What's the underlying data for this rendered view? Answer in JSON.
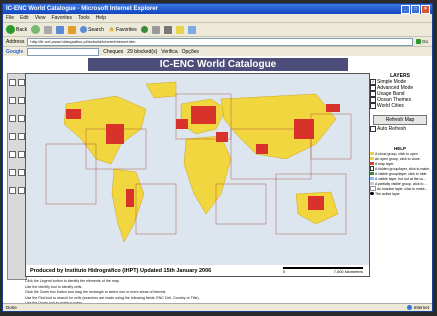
{
  "window": {
    "title": "IC-ENC World Catalogue - Microsoft Internet Explorer"
  },
  "menubar": [
    "File",
    "Edit",
    "View",
    "Favorites",
    "Tools",
    "Help"
  ],
  "toolbar": {
    "back": "Back",
    "search": "Search",
    "favorites": "Favorites"
  },
  "address": {
    "label": "Address",
    "url": "http://ifr-net-www.hidrografico.pt/iscbuild/ichere/internet.htm",
    "go": "Go"
  },
  "googlebar": {
    "label": "Google",
    "checks": "Cheques",
    "blocked": "29 blocked(s)",
    "check": "Verifica",
    "options": "Opções"
  },
  "page": {
    "title": "IC-ENC World Catalogue",
    "credit": "Produced by Instituto Hidrográfico (IHPT) Updated 15th January 2006",
    "scale": {
      "left": "0",
      "right": "7,500 kilometers"
    }
  },
  "layers": {
    "heading": "LAYERS",
    "items": [
      "Simple Mode",
      "Advanced Mode",
      "Usage Band",
      "Ocean Themes",
      "World Cities"
    ],
    "checked": [
      true,
      false,
      false,
      false,
      false
    ],
    "refresh_label": "Refresh Map",
    "auto_refresh": "Auto Refresh"
  },
  "help": {
    "heading": "HELP",
    "items": [
      "A cloud group, click to open.",
      "An open group, click to close.",
      "A map layer.",
      "A hidden group/layer, click to make.",
      "A visible group/layer, click to hide.",
      "A visible layer, but not at the cu...",
      "A partially visible group, click to ...",
      "An inactive layer, click to make...",
      "The active layer."
    ],
    "colors": [
      "#e8d44a",
      "#e8d44a",
      "#d94a2a",
      "#ffffff",
      "#3a8a3a",
      "#7fbfff",
      "#cccccc",
      "#ffffff",
      "#000000"
    ]
  },
  "instructions": [
    "Click the Legend button to identify the elements of the map.",
    "Use the Identify tool to identify cells.",
    "Click the Zoom box button and drag the rectangle to select one or more areas of interest.",
    "Use the Find tool to search for cells (searches are made using the following fields: ENC Cell, Country or Title).",
    "Use the Query tool to make a query."
  ],
  "statusbar": {
    "left": "Done",
    "right": "Internet"
  },
  "colors": {
    "ocean": "#dde6ee",
    "land": "#f2d640",
    "cells": "#d9322a",
    "title_bg": "#4d4d7a"
  }
}
